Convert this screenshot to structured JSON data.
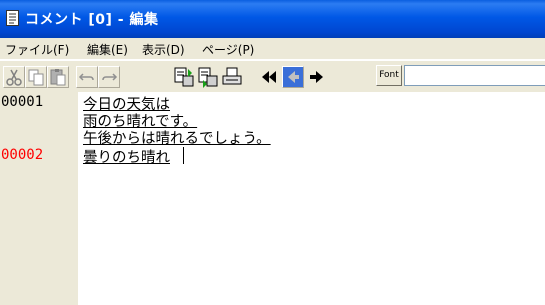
{
  "window": {
    "title": "コメント [0] - 編集"
  },
  "menu": [
    {
      "label": "ファイル(F)"
    },
    {
      "label": "編集(E)"
    },
    {
      "label": "表示(D)"
    },
    {
      "label": "ページ(P)"
    }
  ],
  "toolbar": {
    "font_label": "Font",
    "buttons": [
      "cut-icon",
      "copy-icon",
      "paste-icon",
      "undo-icon",
      "redo-icon",
      "import-icon",
      "export-icon",
      "print-icon",
      "first-page-icon",
      "prev-page-icon",
      "next-page-icon"
    ],
    "input_value": ""
  },
  "editor": {
    "lines": [
      {
        "number": "00001",
        "number_color": "#000000",
        "text": "今日の天気は"
      },
      {
        "number": "",
        "number_color": "#000000",
        "text": "雨のち晴れです。"
      },
      {
        "number": "",
        "number_color": "#000000",
        "text": "午後からは晴れるでしょう。"
      },
      {
        "number": "00002",
        "number_color": "#ff0000",
        "text": "曇りのち晴れ"
      }
    ]
  },
  "colors": {
    "titlebar": "#0054e3",
    "highlight_number": "#ff0000",
    "gutter": "#ece9d8"
  }
}
